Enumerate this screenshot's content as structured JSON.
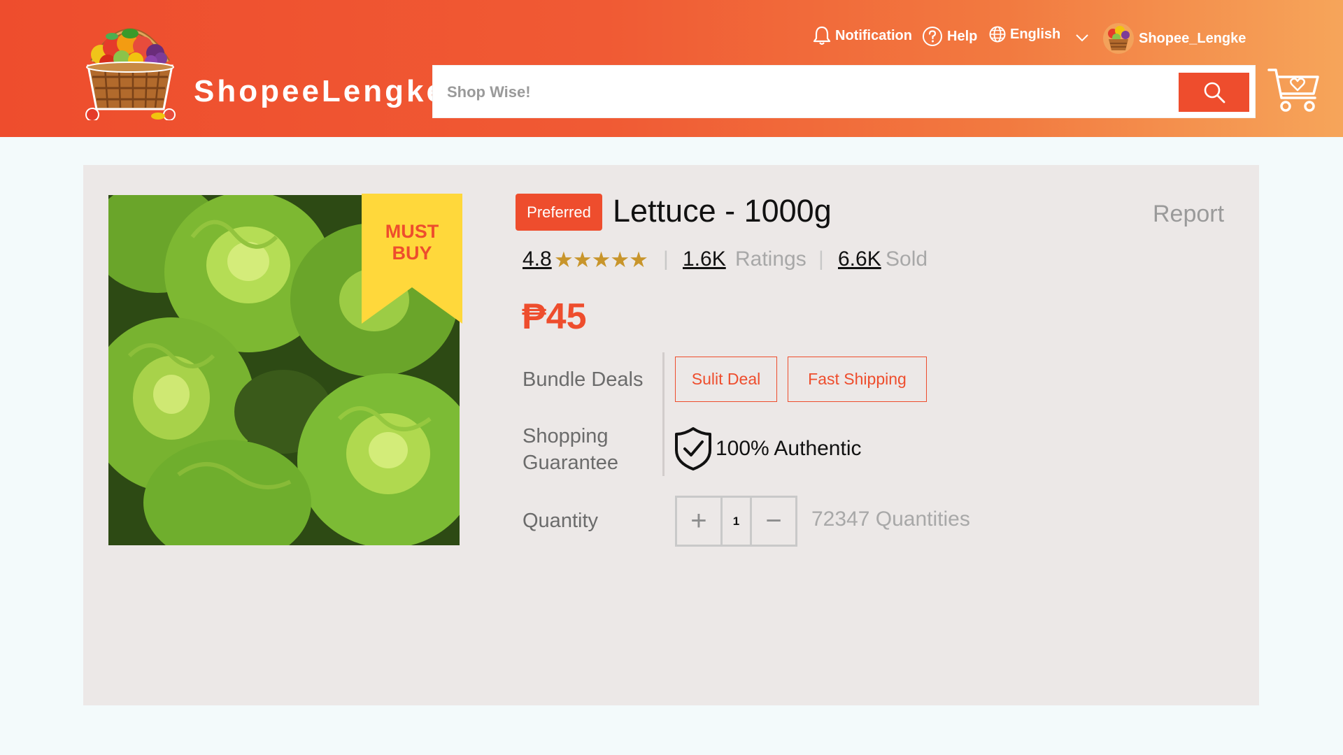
{
  "header": {
    "brand": "ShopeeLengke",
    "nav": {
      "notification": "Notification",
      "help": "Help",
      "language": "English",
      "username": "Shopee_Lengke"
    },
    "search": {
      "placeholder": "Shop Wise!"
    }
  },
  "product": {
    "badge": "Preferred",
    "title": "Lettuce - 1000g",
    "report": "Report",
    "ribbon": [
      "MUST",
      "BUY"
    ],
    "rating": "4.8",
    "stars": "★★★★★",
    "star_value": 5,
    "ratings_count": "1.6K",
    "ratings_label": "Ratings",
    "sold_count": "6.6K",
    "sold_label": "Sold",
    "separator": "|",
    "price": "₱45",
    "bundle_label": "Bundle Deals",
    "deals": [
      "Sulit Deal",
      "Fast Shipping"
    ],
    "guarantee_label_1": "Shopping",
    "guarantee_label_2": "Guarantee",
    "guarantee_text": "100% Authentic",
    "quantity_label": "Quantity",
    "quantity_plus": "+",
    "quantity_value": "1",
    "quantity_minus": "−",
    "stock": "72347 Quantities"
  },
  "colors": {
    "accent": "#ee4d2d",
    "header_end": "#f6a55a",
    "star": "#c8952b",
    "ribbon": "#ffd83b",
    "card_bg": "#ece8e7",
    "page_bg": "#f3fafb"
  }
}
